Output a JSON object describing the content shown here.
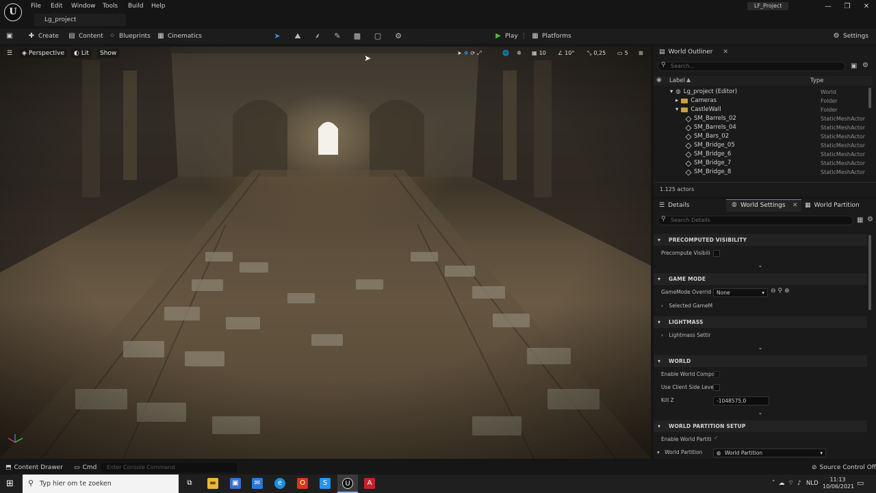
{
  "menu": {
    "items": [
      "File",
      "Edit",
      "Window",
      "Tools",
      "Build",
      "Help"
    ]
  },
  "project_tab": "Lg_project",
  "window_title": "LF_Project",
  "toolbar": {
    "create": "Create",
    "content": "Content",
    "blueprints": "Blueprints",
    "cinematics": "Cinematics",
    "play": "Play",
    "platforms": "Platforms",
    "settings": "Settings"
  },
  "viewport": {
    "perspective": "Perspective",
    "lit": "Lit",
    "show": "Show",
    "grid_snap": "10",
    "rotation_snap": "10°",
    "scale_snap": "0,25",
    "camera_speed": "5"
  },
  "outliner": {
    "tab": "World Outliner",
    "search_placeholder": "Search...",
    "col_label": "Label",
    "col_type": "Type",
    "rows": [
      {
        "label": "Lg_project (Editor)",
        "type": "World"
      },
      {
        "label": "Cameras",
        "type": "Folder"
      },
      {
        "label": "CastleWall",
        "type": "Folder"
      },
      {
        "label": "SM_Barrels_02",
        "type": "StaticMeshActor"
      },
      {
        "label": "SM_Barrels_04",
        "type": "StaticMeshActor"
      },
      {
        "label": "SM_Bars_02",
        "type": "StaticMeshActor"
      },
      {
        "label": "SM_Bridge_05",
        "type": "StaticMeshActor"
      },
      {
        "label": "SM_Bridge_6",
        "type": "StaticMeshActor"
      },
      {
        "label": "SM_Bridge_7",
        "type": "StaticMeshActor"
      },
      {
        "label": "SM_Bridge_8",
        "type": "StaticMeshActor"
      }
    ],
    "actor_count": "1.125 actors"
  },
  "details": {
    "tab_details": "Details",
    "tab_world_settings": "World Settings",
    "tab_world_partition": "World Partition",
    "search_placeholder": "Search Details",
    "sections": {
      "precomputed": "PRECOMPUTED VISIBILITY",
      "game_mode": "GAME MODE",
      "lightmass": "LIGHTMASS",
      "world": "WORLD",
      "world_partition_setup": "WORLD PARTITION SETUP"
    },
    "props": {
      "precompute_visibility": "Precompute Visibili",
      "gamemode_override": "GameMode Overrid",
      "gamemode_value": "None",
      "selected_gamemode": "Selected GameM",
      "lightmass_settings": "Lightmass Settir",
      "enable_world_comp": "Enable World Compo",
      "use_client_side": "Use Client Side Leve",
      "kill_z": "Kill Z",
      "kill_z_value": "-1048575,0",
      "enable_world_partition": "Enable World Partiti",
      "world_partition": "World Partition",
      "world_partition_value": "World Partition"
    }
  },
  "statusbar": {
    "content_drawer": "Content Drawer",
    "cmd": "Cmd",
    "console_placeholder": "Enter Console Command",
    "source_control": "Source Control Off"
  },
  "taskbar": {
    "search_placeholder": "Typ hier om te zoeken",
    "lang": "NLD",
    "time": "11:13",
    "date": "10/06/2021"
  },
  "colors": {
    "play_green": "#4fbf3a",
    "folder": "#c9a23e",
    "accent_blue": "#3f8fd8"
  }
}
